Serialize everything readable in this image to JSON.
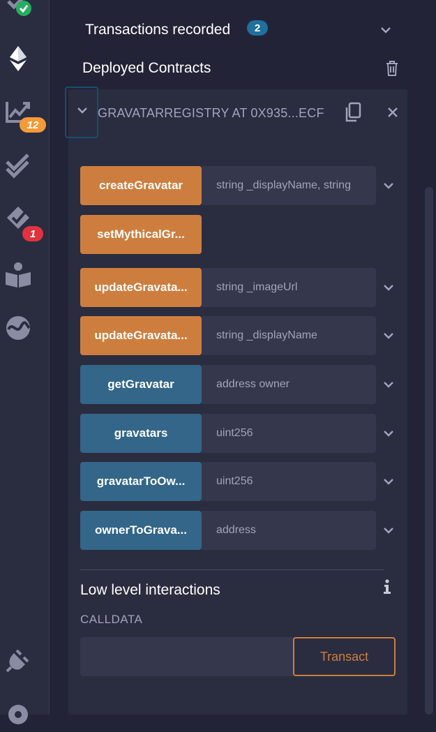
{
  "rail": {
    "icons": [
      "check-icon",
      "ethereum-icon",
      "analytics-icon",
      "double-check-icon",
      "verify-icon",
      "learn-book-icon",
      "wave-icon",
      "plugin-icon",
      "settings-icon"
    ],
    "analytics_badge": "12",
    "verify_badge": "1",
    "colors": {
      "rail_bg": "#2a2c3f",
      "badge_orange": "#f29b38",
      "badge_red": "#e0333f",
      "check_green": "#27ae60"
    }
  },
  "transactions": {
    "label": "Transactions recorded",
    "count": "2"
  },
  "deployed": {
    "label": "Deployed Contracts"
  },
  "contract": {
    "title": "GRAVATARREGISTRY AT 0X935...ECF",
    "functions": [
      {
        "name": "createGravatar",
        "kind": "write",
        "placeholder": "string _displayName, string",
        "has_input": true
      },
      {
        "name": "setMythicalGr...",
        "kind": "write",
        "placeholder": "",
        "has_input": false
      },
      {
        "name": "updateGravata...",
        "kind": "write",
        "placeholder": "string _imageUrl",
        "has_input": true
      },
      {
        "name": "updateGravata...",
        "kind": "write",
        "placeholder": "string _displayName",
        "has_input": true
      },
      {
        "name": "getGravatar",
        "kind": "read",
        "placeholder": "address owner",
        "has_input": true
      },
      {
        "name": "gravatars",
        "kind": "read",
        "placeholder": "uint256",
        "has_input": true
      },
      {
        "name": "gravatarToOw...",
        "kind": "read",
        "placeholder": "uint256",
        "has_input": true
      },
      {
        "name": "ownerToGrava...",
        "kind": "read",
        "placeholder": "address",
        "has_input": true
      }
    ]
  },
  "low_level": {
    "title": "Low level interactions",
    "calldata_label": "CALLDATA",
    "transact_label": "Transact",
    "info_icon": "info-icon"
  },
  "colors": {
    "bg": "#222336",
    "panel": "#2a2c3f",
    "write_btn": "#cd7e3e",
    "read_btn": "#336688",
    "input_bg": "#35374c",
    "muted_text": "#a2a3bd",
    "count_badge": "#1f6f9f"
  }
}
